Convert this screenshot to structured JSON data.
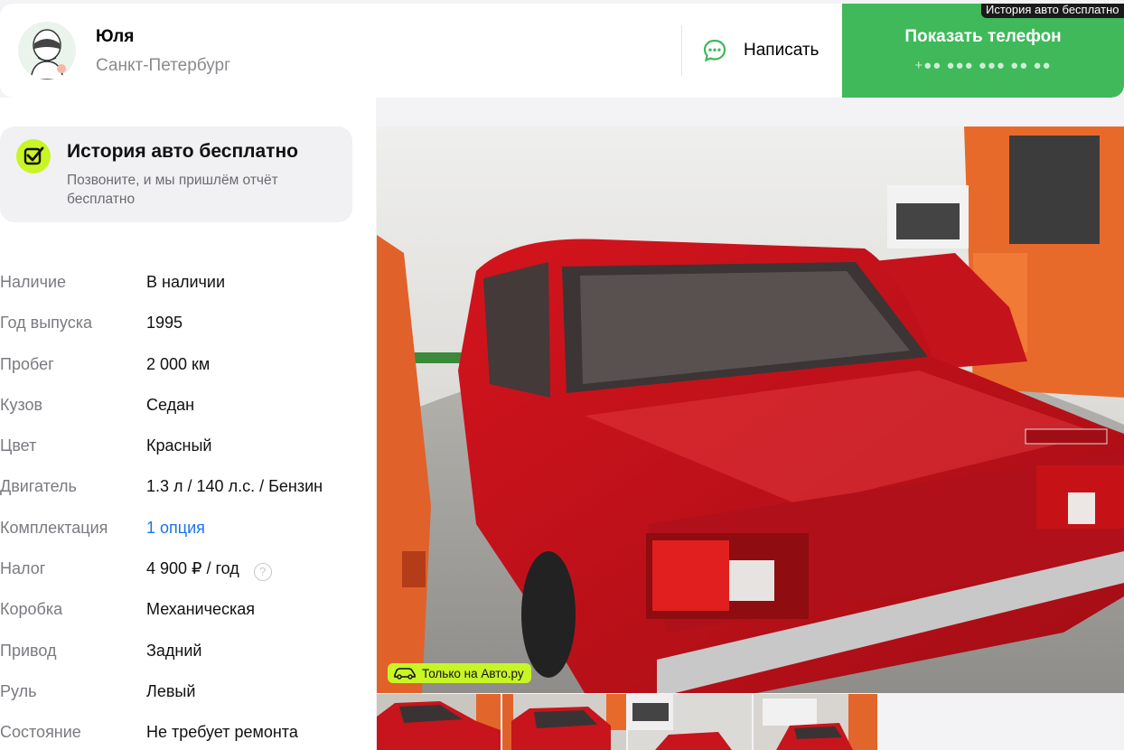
{
  "seller": {
    "name": "Юля",
    "city": "Санкт-Петербург",
    "write_label": "Написать",
    "phone_label": "Показать телефон",
    "phone_masked": "+●● ●●● ●●● ●● ●●",
    "tooltip": "История авто бесплатно"
  },
  "history": {
    "title": "История авто бесплатно",
    "subtitle": "Позвоните, и мы пришлём отчёт бесплатно"
  },
  "specs": [
    {
      "key": "Наличие",
      "value": "В наличии"
    },
    {
      "key": "Год выпуска",
      "value": "1995"
    },
    {
      "key": "Пробег",
      "value": "2 000 км"
    },
    {
      "key": "Кузов",
      "value": "Седан"
    },
    {
      "key": "Цвет",
      "value": "Красный"
    },
    {
      "key": "Двигатель",
      "value": "1.3 л / 140 л.с. / Бензин"
    },
    {
      "key": "Комплектация",
      "value": "1 опция"
    },
    {
      "key": "Налог",
      "value": "4 900 ₽ / год"
    },
    {
      "key": "Коробка",
      "value": "Механическая"
    },
    {
      "key": "Привод",
      "value": "Задний"
    },
    {
      "key": "Руль",
      "value": "Левый"
    },
    {
      "key": "Состояние",
      "value": "Не требует ремонта"
    }
  ],
  "gallery": {
    "badge": "Только на Авто.ру",
    "thumb_count": 4
  },
  "colors": {
    "accent_green": "#3fb95a",
    "badge_lime": "#c8f526",
    "link_blue": "#1a73e8"
  }
}
